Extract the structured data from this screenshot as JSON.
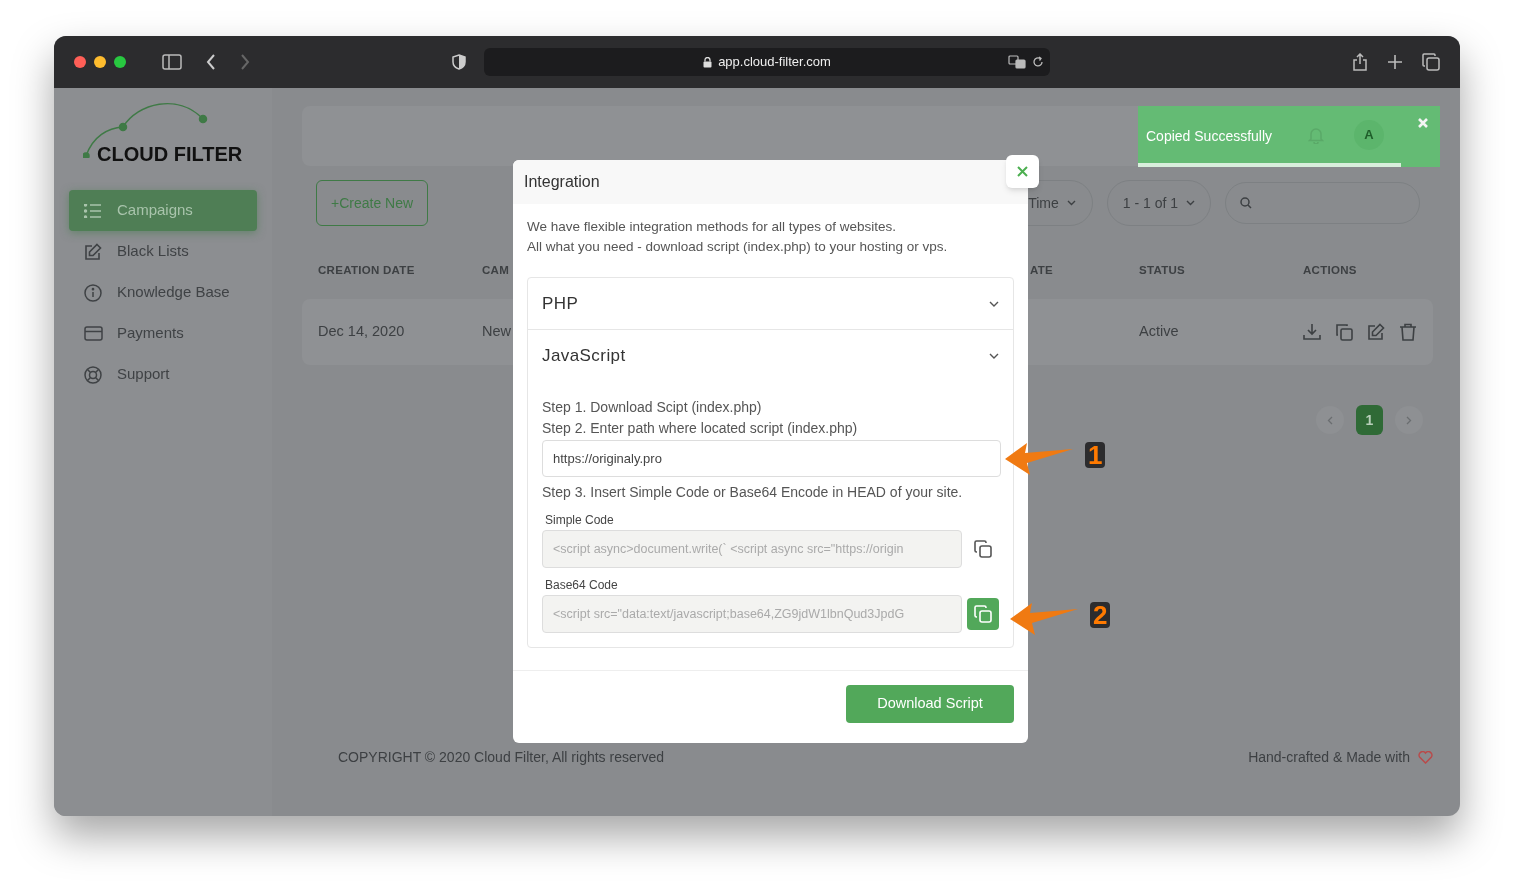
{
  "browser": {
    "url": "app.cloud-filter.com"
  },
  "sidebar": {
    "logo_text": "CLOUD FILTER",
    "items": [
      {
        "label": "Campaigns",
        "selected": true
      },
      {
        "label": "Black Lists",
        "selected": false
      },
      {
        "label": "Knowledge Base",
        "selected": false
      },
      {
        "label": "Payments",
        "selected": false
      },
      {
        "label": "Support",
        "selected": false
      }
    ]
  },
  "toolbar": {
    "create_button": "+Create New",
    "filters": [
      {
        "label": "Time"
      },
      {
        "label": "1 - 1 of 1"
      }
    ]
  },
  "table": {
    "columns": [
      "CREATION DATE",
      "CAM",
      "ATE",
      "STATUS",
      "ACTIONS"
    ],
    "rows": [
      {
        "creation_date": "Dec 14, 2020",
        "column_2": "New",
        "status": "Active"
      }
    ]
  },
  "pagination": {
    "pages": [
      {
        "label": "1",
        "selected": true
      }
    ]
  },
  "footer": {
    "copyright": "COPYRIGHT © 2020 Cloud Filter, All rights reserved",
    "credit": "Hand-crafted & Made with"
  },
  "toast": {
    "message": "Copied Successfully",
    "level": 0.87,
    "avatar_initial": "A"
  },
  "modal": {
    "title": "Integration",
    "intro": [
      "We have flexible integration methods for all types of websites.",
      "All what you need - download script (index.php) to your hosting or vps."
    ],
    "sections": [
      {
        "title": "PHP",
        "expanded": false
      },
      {
        "title": "JavaScript",
        "expanded": true,
        "steps": [
          "Step 1. Download Scipt (index.php)",
          "Step 2. Enter path where located script (index.php)"
        ],
        "url_value": "https://originaly.pro",
        "step_3": "Step 3. Insert Simple Code or Base64 Encode in HEAD of your site.",
        "codes": [
          {
            "label": "Simple Code",
            "value": "<script async>document.write(` <script async src=\"https://origin",
            "copied": false
          },
          {
            "label": "Base64 Code",
            "value": "<script src=\"data:text/javascript;base64,ZG9jdW1lbnQud3JpdG",
            "copied": true
          }
        ]
      }
    ],
    "download_button": "Download Script"
  },
  "annotations": [
    {
      "label": "1"
    },
    {
      "label": "2"
    }
  ]
}
